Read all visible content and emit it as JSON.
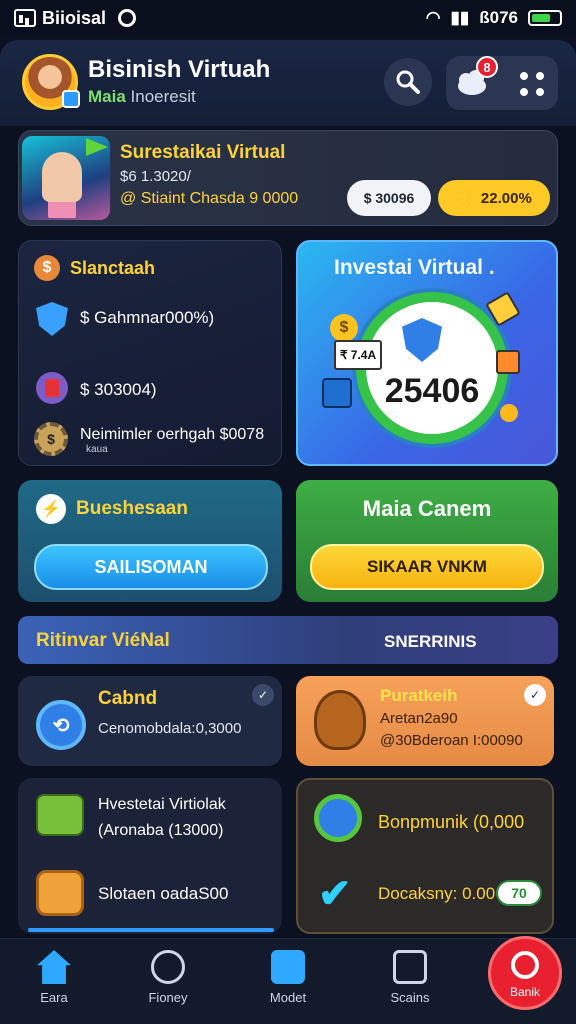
{
  "status_bar": {
    "carrier": "Biioisal",
    "right_text": "ß076"
  },
  "header": {
    "title": "Bisinish Virtuah",
    "subtitle_accent": "Maia",
    "subtitle": "Inoeresit",
    "notification_count": "8"
  },
  "featured": {
    "title": "Surestaikai Virtual",
    "line1": "$6 1.3020/",
    "line2": "@ Stiaint Chasda 9 0000",
    "pill_left": "$ 30096",
    "pill_right": "22.00%"
  },
  "stats": {
    "title": "Slanctaah",
    "row1": "$ Gahmnar000%)",
    "row2": "$ 303004)",
    "row3_line1": "Neimimler oerhgah $0078",
    "row3_line2": "   kaua"
  },
  "invest": {
    "title": "Investai Virtual .",
    "value": "25406",
    "mini_label": "₹ 7.4A"
  },
  "business": {
    "title": "Bueshesaan",
    "button": "SAILISOMAN"
  },
  "game": {
    "title": "Maia Canem",
    "button": "SIKAAR VNKM"
  },
  "banner": {
    "left": "Ritinvar ViéNal",
    "right": "SNERRINIS"
  },
  "tiles": {
    "t1_title": "Cabnd",
    "t1_text": "Cenomobdala:0,3000",
    "t2_title": "Puratkeih",
    "t2_line1": "Aretan2a90",
    "t2_line2": "@30Bderoan I:00090",
    "t3_line1": "Hvestetai Virtiolak",
    "t3_line2": "(Aronaba (13000)",
    "t3_line3": "Slotaen oadaS00",
    "t4_line1": "Bonpmunik (0,000",
    "t4_line2": "Docaksny: 0.00",
    "t4_badge": "70"
  },
  "nav": {
    "home": "Eara",
    "money": "Fioney",
    "model": "Modet",
    "stats": "Scains",
    "profile": "Banik"
  },
  "colors": {
    "accent_yellow": "#ffd23a",
    "accent_blue": "#2f9bff",
    "accent_red": "#e8202f",
    "accent_green": "#33b34a"
  }
}
